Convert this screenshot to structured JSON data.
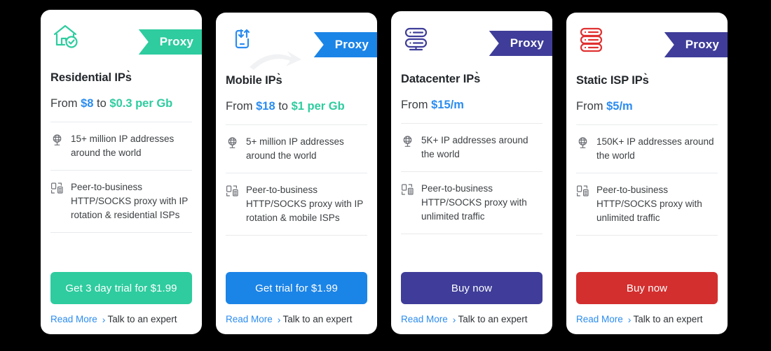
{
  "cards": [
    {
      "id": "residential",
      "icon": "house-check-icon",
      "badge": "Proxy",
      "badge_color": "#2ecc9f",
      "accent": "#2ecc9f",
      "icon_color": "#2ecc9f",
      "title": "Residential IPs̀",
      "price_prefix": "From ",
      "price_a": "$8",
      "price_a_color": "#2b8cf0",
      "price_mid": " to ",
      "price_b": "$0.3 per Gb",
      "price_b_color": "#2ecc9f",
      "features": [
        {
          "icon": "globe-stand-icon",
          "text": "15+ million IP addresses around the world"
        },
        {
          "icon": "server-network-icon",
          "text": "Peer-to-business HTTP/SOCKS proxy with IP rotation & residential ISPs"
        }
      ],
      "cta_label": "Get 3 day trial for $1.99",
      "cta_color": "#2ecc9f",
      "read_more": "Read More",
      "chevron": "›",
      "expert": "Talk to an expert"
    },
    {
      "id": "mobile",
      "icon": "mobile-updown-icon",
      "badge": "Proxy",
      "badge_color": "#1b84e7",
      "accent": "#1b84e7",
      "icon_color": "#2b8cf0",
      "title": "Mobile IPs̀",
      "price_prefix": "From ",
      "price_a": "$18",
      "price_a_color": "#2b8cf0",
      "price_mid": " to ",
      "price_b": "$1 per Gb",
      "price_b_color": "#2ecc9f",
      "features": [
        {
          "icon": "globe-stand-icon",
          "text": "5+ million IP addresses around the world"
        },
        {
          "icon": "server-network-icon",
          "text": "Peer-to-business HTTP/SOCKS proxy with IP rotation & mobile ISPs"
        }
      ],
      "cta_label": "Get trial for $1.99",
      "cta_color": "#1b84e7",
      "read_more": "Read More",
      "chevron": "›",
      "expert": "Talk to an expert"
    },
    {
      "id": "datacenter",
      "icon": "server-rack-two-icon",
      "badge": "Proxy",
      "badge_color": "#3f3d99",
      "accent": "#3f3d99",
      "icon_color": "#3f3d99",
      "title": "Datacenter IPs̀",
      "price_prefix": "From ",
      "price_a": "$15/m",
      "price_a_color": "#2b8cf0",
      "price_mid": "",
      "price_b": "",
      "price_b_color": "#2ecc9f",
      "features": [
        {
          "icon": "globe-stand-icon",
          "text": "5K+ IP addresses around the world"
        },
        {
          "icon": "server-network-icon",
          "text": "Peer-to-business HTTP/SOCKS proxy with unlimited traffic"
        }
      ],
      "cta_label": "Buy now",
      "cta_color": "#3f3d99",
      "read_more": "Read More",
      "chevron": "›",
      "expert": "Talk to an expert"
    },
    {
      "id": "static-isp",
      "icon": "server-rack-three-icon",
      "badge": "Proxy",
      "badge_color": "#3f3d99",
      "accent": "#d32f2f",
      "icon_color": "#e03131",
      "title": "Static ISP IPs̀",
      "price_prefix": "From ",
      "price_a": "$5/m",
      "price_a_color": "#2b8cf0",
      "price_mid": "",
      "price_b": "",
      "price_b_color": "#2ecc9f",
      "features": [
        {
          "icon": "globe-stand-icon",
          "text": "150K+ IP addresses around the world"
        },
        {
          "icon": "server-network-icon",
          "text": "Peer-to-business HTTP/SOCKS proxy with unlimited traffic"
        }
      ],
      "cta_label": "Buy now",
      "cta_color": "#d32f2f",
      "read_more": "Read More",
      "chevron": "›",
      "expert": "Talk to an expert"
    }
  ]
}
